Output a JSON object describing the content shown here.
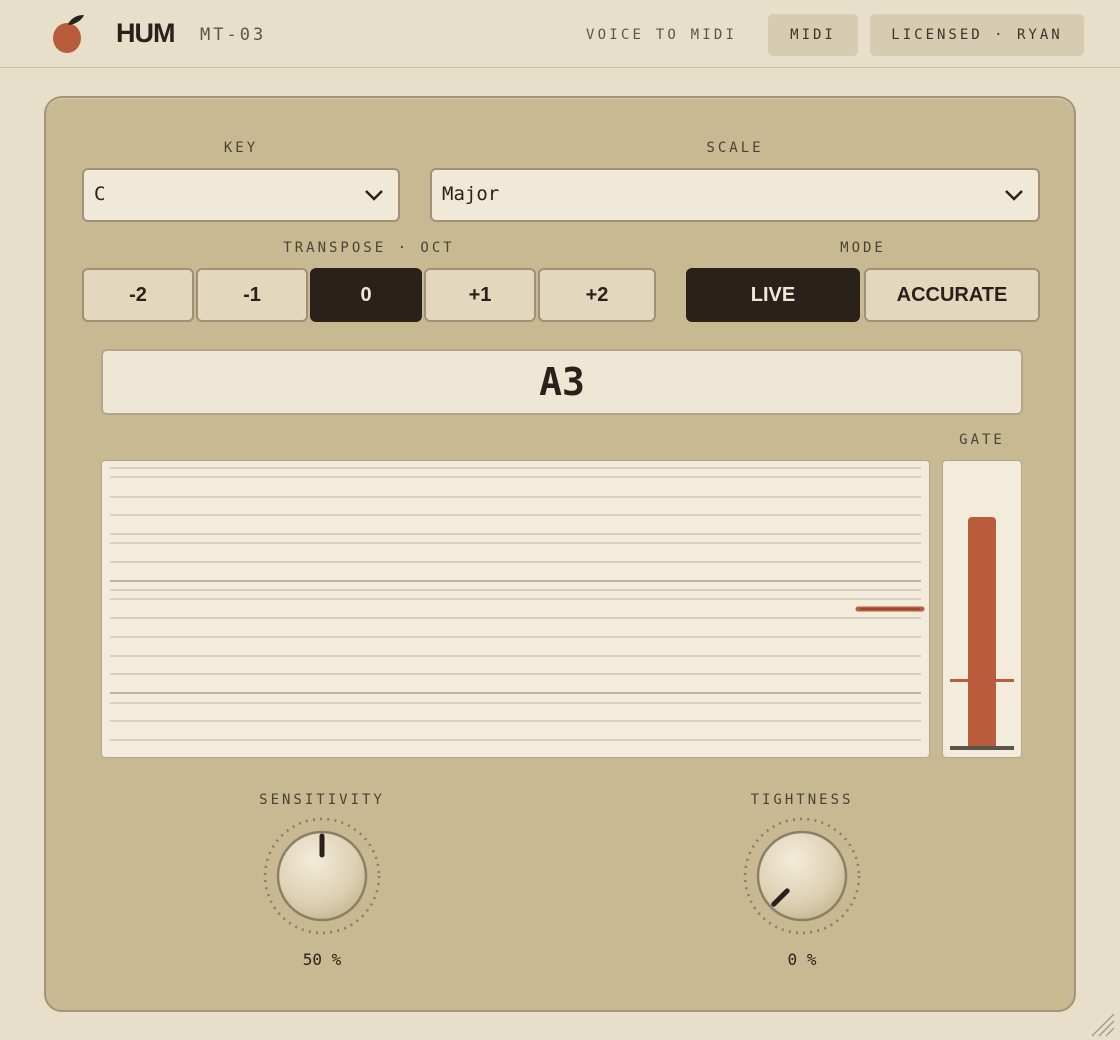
{
  "app": {
    "brand": "HUM",
    "model": "MT-03",
    "tagline": "VOICE TO MIDI",
    "midi_button": "MIDI",
    "license_button": "LICENSED · RYAN",
    "logo_icon": "fruit-icon"
  },
  "colors": {
    "accent": "#b85c3b",
    "dark": "#2a211b",
    "panel": "#c9b993",
    "background": "#e8dfca"
  },
  "key": {
    "label": "KEY",
    "value": "C"
  },
  "scale": {
    "label": "SCALE",
    "value": "Major"
  },
  "transpose": {
    "label": "TRANSPOSE · OCT",
    "options": [
      "-2",
      "-1",
      "0",
      "+1",
      "+2"
    ],
    "selected": "0"
  },
  "mode": {
    "label": "MODE",
    "options": [
      "LIVE",
      "ACCURATE"
    ],
    "selected": "LIVE"
  },
  "note_display": "A3",
  "gate": {
    "label": "GATE",
    "level": 0.83,
    "threshold": 0.25
  },
  "sensitivity": {
    "label": "SENSITIVITY",
    "value": "50 %",
    "level": 0.5
  },
  "tightness": {
    "label": "TIGHTNESS",
    "value": "0 %",
    "level": 0.0
  }
}
